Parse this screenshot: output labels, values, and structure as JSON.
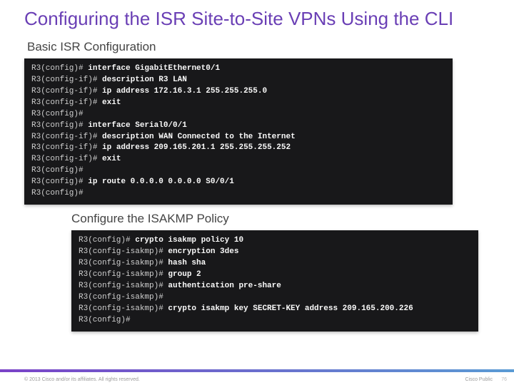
{
  "title": "Configuring the ISR Site-to-Site VPNs Using the CLI",
  "section1": {
    "label": "Basic ISR Configuration",
    "lines": [
      {
        "prompt": "R3(config)# ",
        "cmd": "interface GigabitEthernet0/1"
      },
      {
        "prompt": "R3(config-if)# ",
        "cmd": "description R3 LAN"
      },
      {
        "prompt": "R3(config-if)# ",
        "cmd": "ip address 172.16.3.1 255.255.255.0"
      },
      {
        "prompt": "R3(config-if)# ",
        "cmd": "exit"
      },
      {
        "prompt": "R3(config)#",
        "cmd": ""
      },
      {
        "prompt": "R3(config)# ",
        "cmd": "interface Serial0/0/1"
      },
      {
        "prompt": "R3(config-if)# ",
        "cmd": "description WAN Connected to the Internet"
      },
      {
        "prompt": "R3(config-if)# ",
        "cmd": "ip address 209.165.201.1 255.255.255.252"
      },
      {
        "prompt": "R3(config-if)# ",
        "cmd": "exit"
      },
      {
        "prompt": "R3(config)#",
        "cmd": ""
      },
      {
        "prompt": "R3(config)# ",
        "cmd": "ip route 0.0.0.0 0.0.0.0 S0/0/1"
      },
      {
        "prompt": "R3(config)#",
        "cmd": ""
      }
    ]
  },
  "section2": {
    "label": "Configure the ISAKMP Policy",
    "lines": [
      {
        "prompt": "R3(config)# ",
        "cmd": "crypto isakmp policy 10"
      },
      {
        "prompt": "R3(config-isakmp)# ",
        "cmd": "encryption 3des"
      },
      {
        "prompt": "R3(config-isakmp)# ",
        "cmd": "hash sha"
      },
      {
        "prompt": "R3(config-isakmp)# ",
        "cmd": "group 2"
      },
      {
        "prompt": "R3(config-isakmp)# ",
        "cmd": "authentication pre-share"
      },
      {
        "prompt": "R3(config-isakmp)#",
        "cmd": ""
      },
      {
        "prompt": "R3(config-isakmp)# ",
        "cmd": "crypto isakmp key SECRET-KEY address 209.165.200.226"
      },
      {
        "prompt": "R3(config)#",
        "cmd": ""
      }
    ]
  },
  "footer": {
    "left": "© 2013 Cisco and/or its affiliates. All rights reserved.",
    "right": "Cisco Public",
    "page": "76"
  }
}
